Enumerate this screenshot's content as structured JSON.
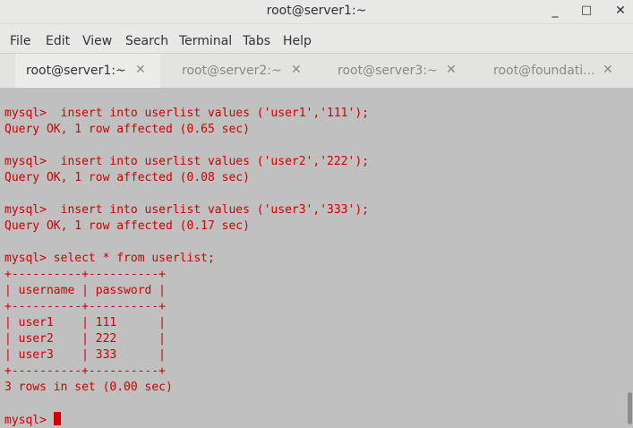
{
  "window": {
    "title": "root@server1:~",
    "controls": {
      "minimize": "_",
      "maximize": "□",
      "close": "✕"
    }
  },
  "menu": [
    "File",
    "Edit",
    "View",
    "Search",
    "Terminal",
    "Tabs",
    "Help"
  ],
  "tabs": [
    {
      "label": "root@server1:~",
      "active": true
    },
    {
      "label": "root@server2:~",
      "active": false
    },
    {
      "label": "root@server3:~",
      "active": false
    },
    {
      "label": "root@foundati...",
      "active": false
    }
  ],
  "tab_close_glyph": "✕",
  "terminal": {
    "text_color": "#cc0000",
    "background": "#c0c0c0",
    "lines": [
      "mysql>  insert into userlist values ('user1','111');",
      "Query OK, 1 row affected (0.65 sec)",
      "",
      "mysql>  insert into userlist values ('user2','222');",
      "Query OK, 1 row affected (0.08 sec)",
      "",
      "mysql>  insert into userlist values ('user3','333');",
      "Query OK, 1 row affected (0.17 sec)",
      "",
      "mysql> select * from userlist;",
      "+----------+----------+",
      "| username | password |",
      "+----------+----------+",
      "| user1    | 111      |",
      "| user2    | 222      |",
      "| user3    | 333      |",
      "+----------+----------+",
      "3 rows in set (0.00 sec)",
      ""
    ],
    "prompt": "mysql> "
  }
}
